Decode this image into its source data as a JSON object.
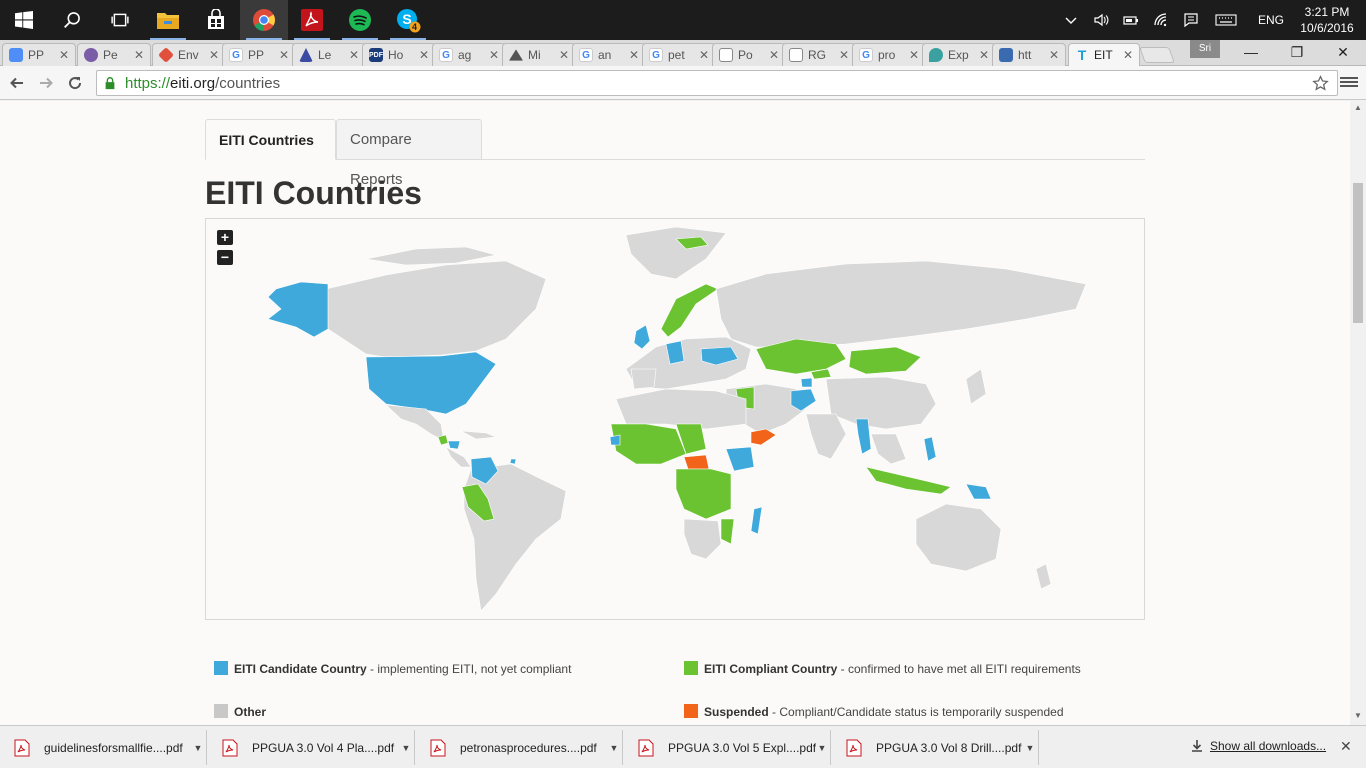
{
  "taskbar": {
    "apps": [
      {
        "name": "file-explorer",
        "color": "#f3c13a"
      },
      {
        "name": "store",
        "color": "#ffffff"
      },
      {
        "name": "chrome",
        "color": "#dd4b39"
      },
      {
        "name": "acrobat",
        "color": "#c4141b"
      },
      {
        "name": "spotify",
        "color": "#1db954"
      },
      {
        "name": "skype",
        "color": "#00aff0",
        "badge": "4"
      }
    ],
    "lang": "ENG",
    "time": "3:21 PM",
    "date": "10/6/2016"
  },
  "browser": {
    "tabs": [
      {
        "label": "PP",
        "fav_color": "#4f8ef7"
      },
      {
        "label": "Pe",
        "fav_color": "#7b5ca7"
      },
      {
        "label": "Env",
        "fav_color": "#e0503a"
      },
      {
        "label": "PP",
        "fav_color": "#4285f4"
      },
      {
        "label": "Le",
        "fav_color": "#3b4ba3"
      },
      {
        "label": "Ho",
        "fav_color": "#1b3c78"
      },
      {
        "label": "ag",
        "fav_color": "#4285f4"
      },
      {
        "label": "Mi",
        "fav_color": "#555555"
      },
      {
        "label": "an",
        "fav_color": "#4285f4"
      },
      {
        "label": "pet",
        "fav_color": "#4285f4"
      },
      {
        "label": "Po",
        "fav_color": "#888888"
      },
      {
        "label": "RG",
        "fav_color": "#888888"
      },
      {
        "label": "pro",
        "fav_color": "#4285f4"
      },
      {
        "label": "Exp",
        "fav_color": "#3aa0a0"
      },
      {
        "label": "htt",
        "fav_color": "#3a6ab0"
      },
      {
        "label": "EIT",
        "fav_color": "#1da0d8",
        "active": true
      }
    ],
    "profile": "Sri",
    "url_scheme": "https://",
    "url_host": "eiti.org",
    "url_path": "/countries"
  },
  "page": {
    "tabs": [
      "EITI Countries",
      "Compare Reports"
    ],
    "title": "EITI Countries",
    "zoom_in": "+",
    "zoom_out": "−",
    "legend": [
      {
        "color": "#3fa9db",
        "bold": "EITI Candidate Country",
        "text": " - implementing EITI, not yet compliant"
      },
      {
        "color": "#6cc332",
        "bold": "EITI Compliant Country",
        "text": " - confirmed to have met all EITI requirements"
      },
      {
        "color": "#c8c8c8",
        "bold": "Other",
        "text": ""
      },
      {
        "color": "#f26419",
        "bold": "Suspended",
        "text": " - Compliant/Candidate status is temporarily suspended"
      }
    ],
    "colors": {
      "candidate": "#3fa9db",
      "compliant": "#6cc332",
      "other": "#d8d8d8",
      "suspended": "#f26419"
    }
  },
  "downloads": {
    "items": [
      "guidelinesforsmallfie....pdf",
      "PPGUA 3.0 Vol 4 Pla....pdf",
      "petronasprocedures....pdf",
      "PPGUA 3.0 Vol 5 Expl....pdf",
      "PPGUA 3.0 Vol 8 Drill....pdf"
    ],
    "show_all": "Show all downloads..."
  }
}
